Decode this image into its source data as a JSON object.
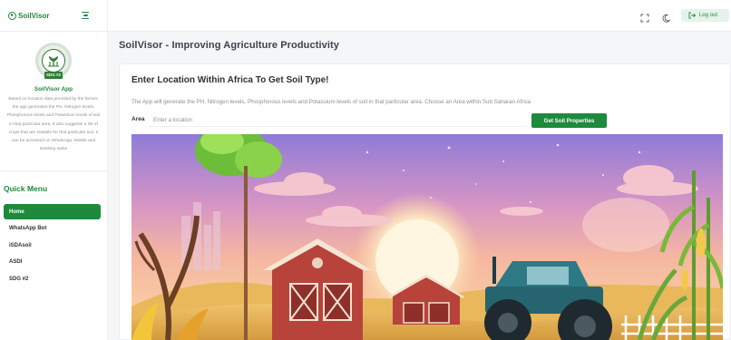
{
  "brand": {
    "name": "SoilVisor"
  },
  "profile": {
    "badge_text": "SDG #2",
    "title": "SoilVisor App",
    "description": "Based on location data provided by the farmer, the app generates the PH, Nitrogen levels, Phosphorous levels and Potassium levels of soil in that particular area. It also suggests a list of crops that are suitable for that particular soil. It can be accessed on WhatsApp, Mobile and Desktop webs"
  },
  "quick_menu": {
    "title": "Quick Menu",
    "items": [
      {
        "label": "Home",
        "active": true
      },
      {
        "label": "WhatsApp Bot",
        "active": false
      },
      {
        "label": "iSDAsoil",
        "active": false
      },
      {
        "label": "ASDI",
        "active": false
      },
      {
        "label": "SDG #2",
        "active": false
      }
    ]
  },
  "header": {
    "fullscreen_icon": "fullscreen-icon",
    "theme_icon": "moon-icon",
    "logout_label": "Log out",
    "logout_icon": "logout-icon"
  },
  "page": {
    "title": "SoilVisor - Improving Agriculture Productivity"
  },
  "card": {
    "heading": "Enter Location Within Africa To Get Soil Type!",
    "description": "The App will generate the PH, Nitrogen levels, Phosphorous levels and Potassium levels of soil in that particular area. Choose an Area within Sub Saharan Africa",
    "area_label": "Area",
    "area_placeholder": "Enter a location",
    "area_value": "",
    "button_label": "Get Soil Properties"
  },
  "colors": {
    "accent": "#1d8a3c",
    "accent_light": "#e6f3ea"
  }
}
